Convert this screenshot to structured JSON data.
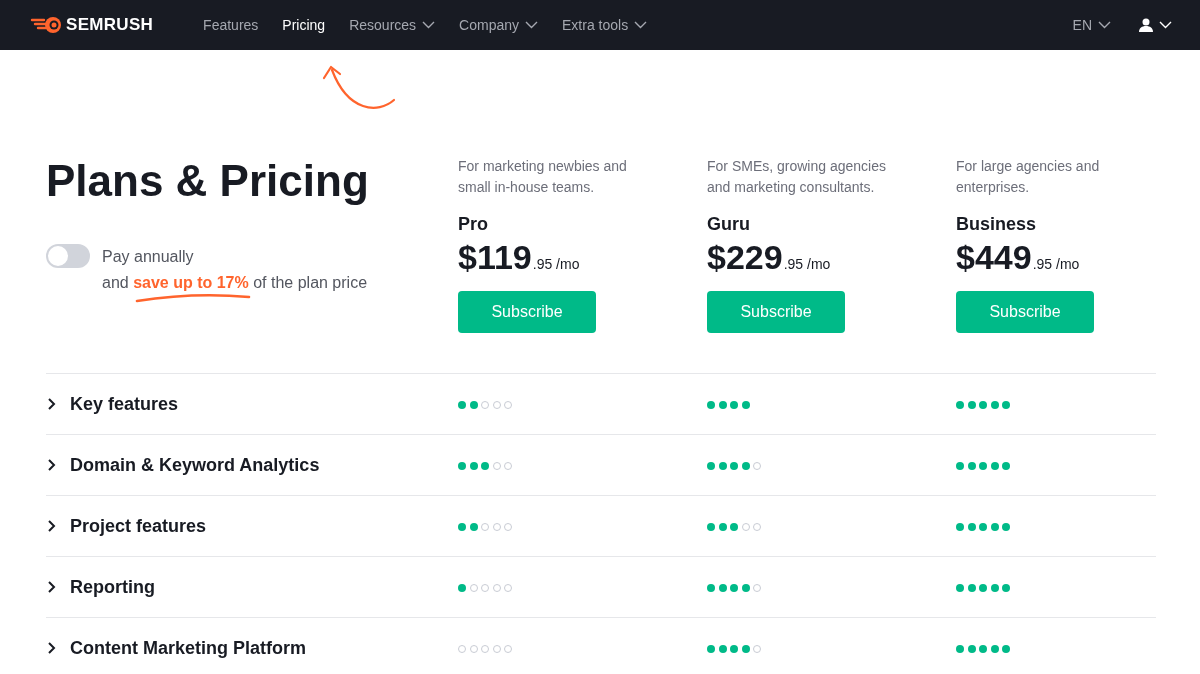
{
  "header": {
    "logo": "SEMRUSH",
    "nav": [
      {
        "label": "Features",
        "selected": false,
        "dropdown": false
      },
      {
        "label": "Pricing",
        "selected": true,
        "dropdown": false
      },
      {
        "label": "Resources",
        "selected": false,
        "dropdown": true
      },
      {
        "label": "Company",
        "selected": false,
        "dropdown": true
      },
      {
        "label": "Extra tools",
        "selected": false,
        "dropdown": true
      }
    ],
    "language": "EN"
  },
  "title": "Plans & Pricing",
  "billing": {
    "on": false,
    "label": "Pay annually",
    "note": "and **save up to 17%** of the plan price"
  },
  "plans": [
    {
      "description": "For marketing newbies and small in-house teams.",
      "name": "Pro",
      "price": "$119",
      "cents": ".95 /mo",
      "button": "Subscribe"
    },
    {
      "description": "For SMEs, growing agencies and marketing consultants.",
      "name": "Guru",
      "price": "$229",
      "cents": ".95 /mo",
      "button": "Subscribe"
    },
    {
      "description": "For large agencies and enterprises.",
      "name": "Business",
      "price": "$449",
      "cents": ".95 /mo",
      "button": "Subscribe"
    }
  ],
  "features": [
    {
      "label": "Key features",
      "expanded": false,
      "cells": [
        {
          "stars": 2,
          "show_empty": true
        },
        {
          "stars": 4,
          "show_empty": false
        },
        {
          "stars": 5
        }
      ]
    },
    {
      "label": "Domain & Keyword Analytics",
      "expanded": false,
      "cells": [
        {
          "stars": 3,
          "show_empty": true
        },
        {
          "stars": 4,
          "show_empty": true
        },
        {
          "stars": 5
        }
      ]
    },
    {
      "label": "Project features",
      "expanded": false,
      "cells": [
        {
          "stars": 2,
          "show_empty": true
        },
        {
          "stars": 3,
          "show_empty": true
        },
        {
          "stars": 5
        }
      ]
    },
    {
      "label": "Reporting",
      "expanded": false,
      "cells": [
        {
          "stars": 1,
          "show_empty": true
        },
        {
          "stars": 4,
          "show_empty": true
        },
        {
          "stars": 5
        }
      ]
    },
    {
      "label": "Content Marketing Platform",
      "expanded": false,
      "cells": [
        {
          "stars": 0,
          "show_empty": true
        },
        {
          "stars": 4,
          "show_empty": true
        },
        {
          "stars": 5
        }
      ]
    }
  ]
}
